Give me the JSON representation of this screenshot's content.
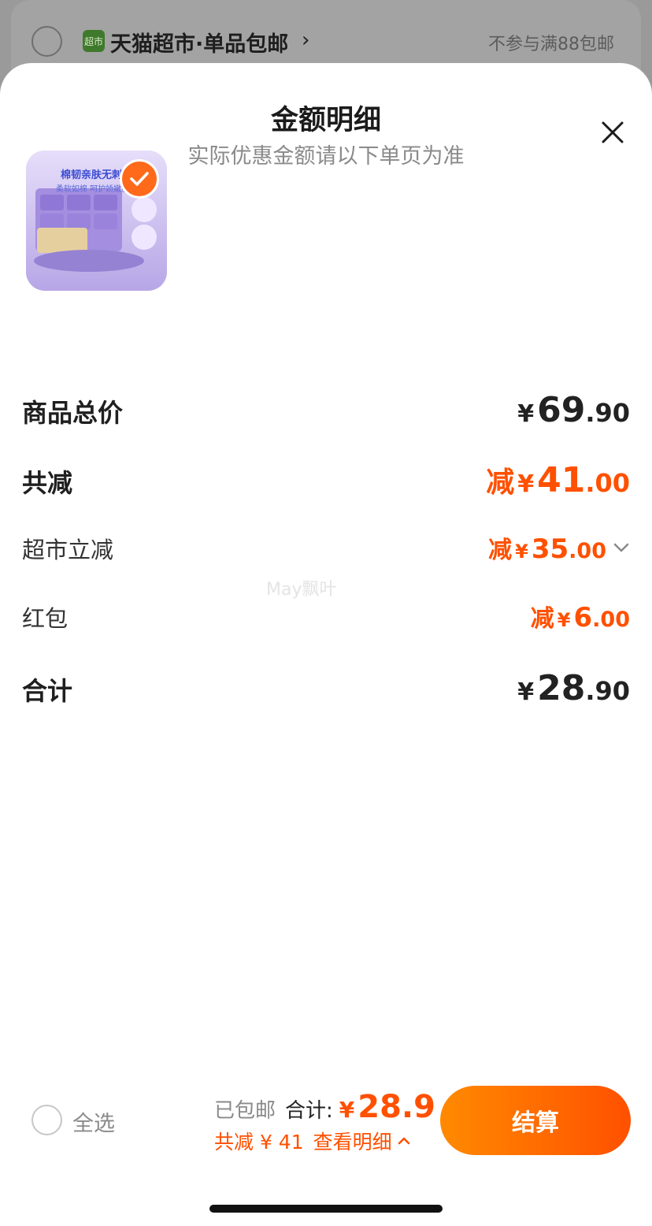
{
  "store": {
    "logo_text": "超市",
    "name": "天猫超市·单品包邮",
    "note": "不参与满88包邮"
  },
  "sheet": {
    "title": "金额明细",
    "subtitle": "实际优惠金额请以下单页为准",
    "close_icon": "close-icon"
  },
  "product": {
    "headline": "棉韧亲肤无刺激",
    "tagline": "柔软如棉 呵护娇嫩肌肤",
    "selected": true
  },
  "rows": {
    "subtotal": {
      "label": "商品总价",
      "currency": "¥",
      "int": "69",
      "dec": ".90"
    },
    "total_discount": {
      "label": "共减",
      "prefix": "减",
      "currency": "¥",
      "int": "41",
      "dec": ".00"
    },
    "market_discount": {
      "label": "超市立减",
      "prefix": "减",
      "currency": "¥",
      "int": "35",
      "dec": ".00"
    },
    "red_packet": {
      "label": "红包",
      "prefix": "减",
      "currency": "¥",
      "int": "6",
      "dec": ".00"
    },
    "total": {
      "label": "合计",
      "currency": "¥",
      "int": "28",
      "dec": ".90"
    }
  },
  "watermark": "May飘叶",
  "bottom_bar": {
    "select_all": "全选",
    "shipping": "已包邮",
    "total_label": "合计:",
    "total_currency": "¥",
    "total_value": "28.9",
    "discount_text": "共减 ¥ 41",
    "details_link": "查看明细",
    "checkout": "结算"
  },
  "colors": {
    "accent": "#ff5000",
    "gradient_start": "#ff8a00"
  }
}
